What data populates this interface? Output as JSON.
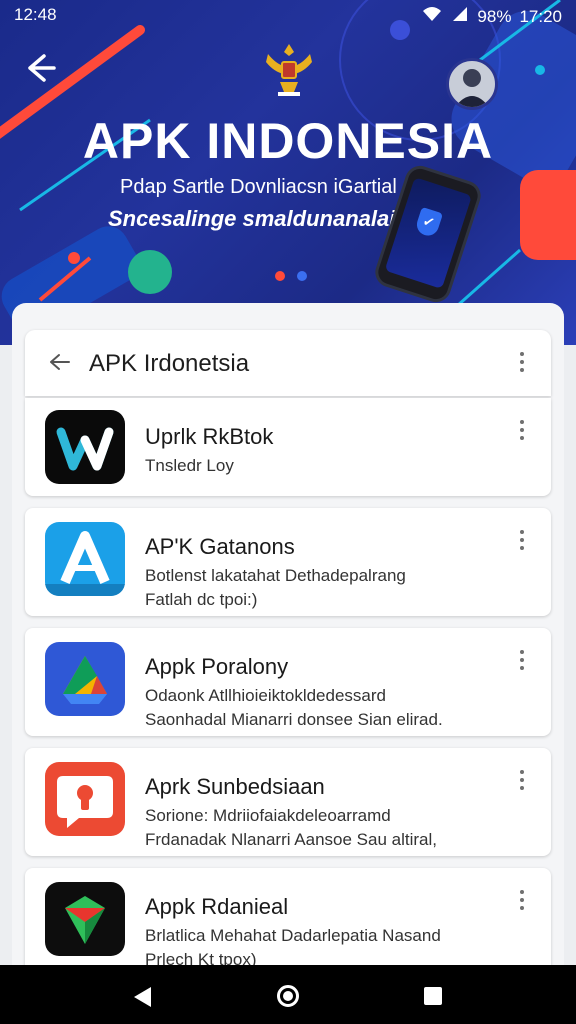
{
  "status_bar": {
    "left_time": "12:48",
    "battery": "98%",
    "clock": "17:20"
  },
  "hero": {
    "title": "APK INDONESIA",
    "subtitle_line1": "Pdap Sartle Dovnliacsn iGartial",
    "subtitle_line2": "Sncesalinge smaldunanalai"
  },
  "toolbar": {
    "title": "APK Irdonetsia"
  },
  "apps": [
    {
      "name": "Uprlk RkBtok",
      "desc1": "Tnsledr Loy",
      "desc2": "",
      "icon": "w-logo-icon",
      "bg": "#0a0a0a"
    },
    {
      "name": "AP'K Gatanons",
      "desc1": "Botlenst lakatahat Dethadepalrang",
      "desc2": "Fatlah dc tpoi:)",
      "icon": "a-logo-icon",
      "bg": "#1ba0e8"
    },
    {
      "name": "Appk Poralony",
      "desc1": "Odaonk Atllhioieiktokldedessard",
      "desc2": "Saonhadal Mianarri donsee Sian elirad.",
      "icon": "drive-triangle-icon",
      "bg": "#2f58d6"
    },
    {
      "name": "Aprk Sunbedsiaan",
      "desc1": "Sorione: Mdriiofaiakdeleoarramd",
      "desc2": "Frdanadak Nlanarri Aansoe Sau altiral,",
      "icon": "keyhole-chat-icon",
      "bg": "#ec4a33"
    },
    {
      "name": "Appk Rdanieal",
      "desc1": "Brlatlica Mehahat Dadarlepatia Nasand",
      "desc2": "Prlech Kt tpox)",
      "icon": "gem-logo-icon",
      "bg": "#0d0d0d"
    }
  ],
  "colors": {
    "hero_bg": "#1f2d93",
    "accent_red": "#ff4a3a",
    "accent_cyan": "#18b8e6"
  }
}
